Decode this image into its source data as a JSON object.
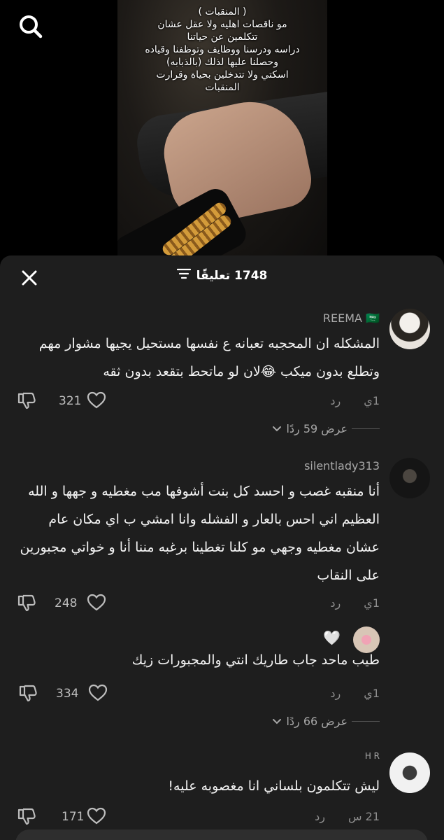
{
  "video": {
    "overlay_lines": [
      "( المنقبات )",
      "مو ناقصات اهليه ولا عقل عشان",
      "تتكلمين عن حياتنا",
      "دراسه ودرسنا ووظايف وتوظفنا وقياده",
      "وحصلنا عليها لذلك (بالذبابه)",
      "اسكتي ولا تتدخلين بحياة وقرارت",
      "المنقبات"
    ]
  },
  "sheet": {
    "count_text": "1748 تعليقًا",
    "icons": {
      "close": "close-icon",
      "sort": "filter-icon",
      "search": "search-icon"
    }
  },
  "comments": [
    {
      "username": "REEMA 🇸🇦",
      "text": "المشكله ان المحجبه تعبانه ع نفسها مستحيل يجيها مشوار مهم وتطلع بدون ميكب 😂لان لو ماتحط بتقعد بدون ثقه",
      "time": "1ي",
      "reply": "رد",
      "likes": "321",
      "view_replies": "عرض 59 ردًا"
    },
    {
      "username": "silentlady313",
      "text": "أنا منقبه غصب و احسد كل بنت أشوفها مب مغطيه و جهها و الله العظيم اني احس بالعار و الفشله وانا امشي ب اي مكان عام عشان مغطيه وجهي مو كلنا تغطينا برغبه مننا أنا و خواتي مجبورين على النقاب",
      "time": "1ي",
      "reply": "رد",
      "likes": "248"
    },
    {
      "username": "🤍",
      "text": "طيب ماحد جاب طاريك انتي والمجبورات زيك",
      "time": "1ي",
      "reply": "رد",
      "likes": "334",
      "view_replies": "عرض 66 ردًا"
    },
    {
      "username": "H R",
      "text": "ليش تتكلمون بلساني انا مغصوبه عليه!",
      "time": "21 س",
      "reply": "رد",
      "likes": "171"
    }
  ],
  "colors": {
    "sheet_bg": "#1e1e1e",
    "secondary_text": "#8e8e8e",
    "username_text": "#a8a8a8"
  }
}
